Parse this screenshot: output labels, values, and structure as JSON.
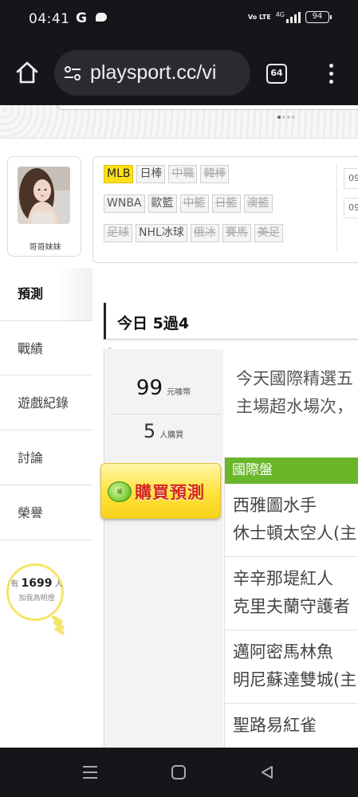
{
  "status_bar": {
    "time": "04:41",
    "g_icon": "G",
    "volte": "Vo LTE",
    "network": "4G",
    "battery": "94"
  },
  "browser": {
    "url": "playsport.cc/vi",
    "tab_count": "64"
  },
  "profile": {
    "name": "哥哥妹妹"
  },
  "sidebar": {
    "items": [
      {
        "label": "預測"
      },
      {
        "label": "戰績"
      },
      {
        "label": "遊戲紀錄"
      },
      {
        "label": "討論"
      },
      {
        "label": "榮譽"
      }
    ]
  },
  "fans": {
    "prefix": "有",
    "count": "1699",
    "suffix": "人",
    "subtitle": "加我為明燈"
  },
  "leagues": {
    "row1": [
      {
        "label": "MLB",
        "state": "active"
      },
      {
        "label": "日棒",
        "state": "normal"
      },
      {
        "label": "中職",
        "state": "disabled"
      },
      {
        "label": "韓棒",
        "state": "disabled"
      }
    ],
    "row2": [
      {
        "label": "WNBA",
        "state": "normal"
      },
      {
        "label": "歐籃",
        "state": "normal"
      },
      {
        "label": "中籃",
        "state": "disabled"
      },
      {
        "label": "日籃",
        "state": "disabled"
      },
      {
        "label": "澳籃",
        "state": "disabled"
      }
    ],
    "row3": [
      {
        "label": "足球",
        "state": "disabled"
      },
      {
        "label": "NHL冰球",
        "state": "normal"
      },
      {
        "label": "俄冰",
        "state": "disabled"
      },
      {
        "label": "賽馬",
        "state": "disabled"
      },
      {
        "label": "美足",
        "state": "disabled"
      }
    ],
    "dates": [
      "09",
      "09"
    ]
  },
  "tab": {
    "label": "今日 5過4"
  },
  "pricing": {
    "price": "99",
    "price_unit": "元噱幣",
    "buyers": "5",
    "buyers_unit": "人購買"
  },
  "buy_button": {
    "coin_text": "噱",
    "label": "購買預測"
  },
  "description": {
    "line1": "今天國際精選五",
    "line2": "主場超水場次，"
  },
  "picks": {
    "header": "國際盤",
    "rows": [
      {
        "away": "西雅圖水手",
        "home": "休士頓太空人(主"
      },
      {
        "away": "辛辛那堤紅人",
        "home": "克里夫蘭守護者"
      },
      {
        "away": "邁阿密馬林魚",
        "home": "明尼蘇達雙城(主"
      },
      {
        "away": "聖路易紅雀",
        "home": ""
      }
    ]
  },
  "colors": {
    "system_bar": "#17151a",
    "accent_yellow": "#ffe01b",
    "pick_header_green": "#6ab62a",
    "buy_text_red": "#d42a1a"
  },
  "icons": {
    "home": "home-icon",
    "site_settings": "tune-icon",
    "menu": "more-vert-icon",
    "nav_recents": "recents-icon",
    "nav_home": "nav-home-icon",
    "nav_back": "back-icon"
  }
}
